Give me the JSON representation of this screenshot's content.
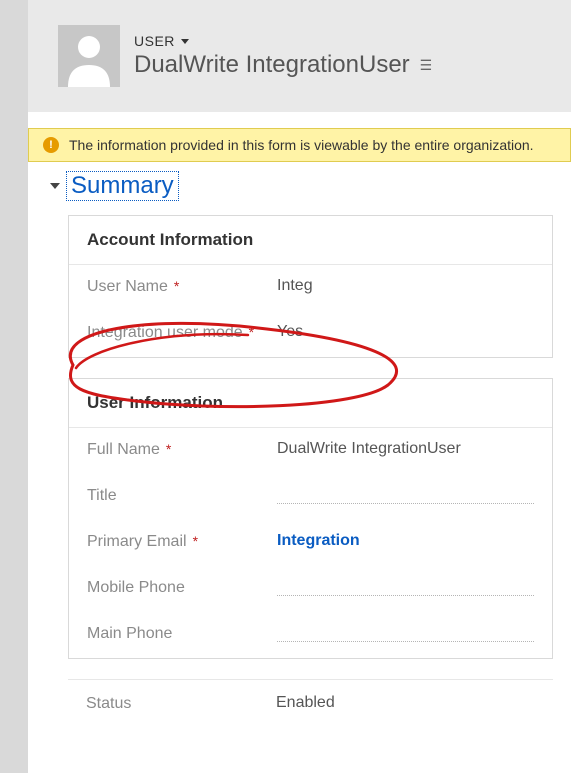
{
  "header": {
    "entity_label": "USER",
    "record_title": "DualWrite IntegrationUser"
  },
  "banner": {
    "message": "The information provided in this form is viewable by the entire organization."
  },
  "section": {
    "title": "Summary"
  },
  "account_info": {
    "heading": "Account Information",
    "username_label": "User Name",
    "username_value": "Integ",
    "integration_label": "Integration user mode",
    "integration_value": "Yes"
  },
  "user_info": {
    "heading": "User Information",
    "fullname_label": "Full Name",
    "fullname_value": "DualWrite IntegrationUser",
    "title_label": "Title",
    "title_value": "",
    "email_label": "Primary Email",
    "email_value": "Integration",
    "mobile_label": "Mobile Phone",
    "mobile_value": "",
    "mainphone_label": "Main Phone",
    "mainphone_value": ""
  },
  "status": {
    "label": "Status",
    "value": "Enabled"
  }
}
